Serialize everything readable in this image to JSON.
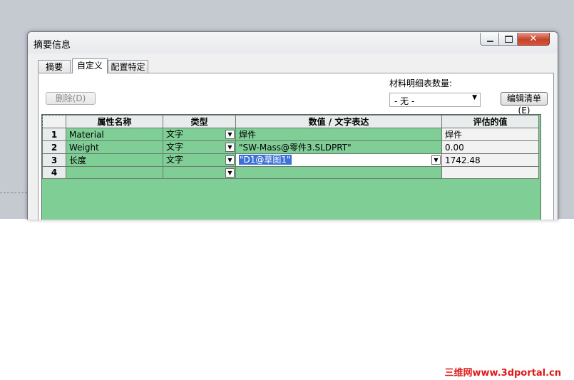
{
  "window": {
    "title": "摘要信息",
    "close_glyph": "✕"
  },
  "tabs": [
    {
      "label": "摘要"
    },
    {
      "label": "自定义",
      "active": true
    },
    {
      "label": "配置特定"
    }
  ],
  "toolbar": {
    "delete_label": "删除(D)",
    "bom_quantity_label": "材料明细表数量:",
    "bom_quantity_value": "- 无 -",
    "edit_list_label": "编辑清单(E)"
  },
  "table": {
    "columns": [
      "属性名称",
      "类型",
      "数值 / 文字表达",
      "评估的值"
    ],
    "rows": [
      {
        "num": "1",
        "name": "Material",
        "type": "文字",
        "value": "焊件",
        "evaluated": "焊件"
      },
      {
        "num": "2",
        "name": "Weight",
        "type": "文字",
        "value": "\"SW-Mass@零件3.SLDPRT\"",
        "evaluated": "0.00"
      },
      {
        "num": "3",
        "name": "长度",
        "type": "文字",
        "value": "\"D1@草图1\"",
        "evaluated": "1742.48",
        "selected": true
      },
      {
        "num": "4",
        "name": "",
        "type": "",
        "value": "",
        "evaluated": ""
      }
    ]
  },
  "icons": {
    "dropdown": "▼",
    "minimize": "minimize-icon",
    "maximize": "maximize-icon",
    "close": "close-icon"
  },
  "colors": {
    "grid_background": "#7fce96",
    "selection": "#3c72d6",
    "close_button": "#c7432b",
    "watermark": "#e01a1a"
  },
  "watermark": "三维网www.3dportal.cn"
}
